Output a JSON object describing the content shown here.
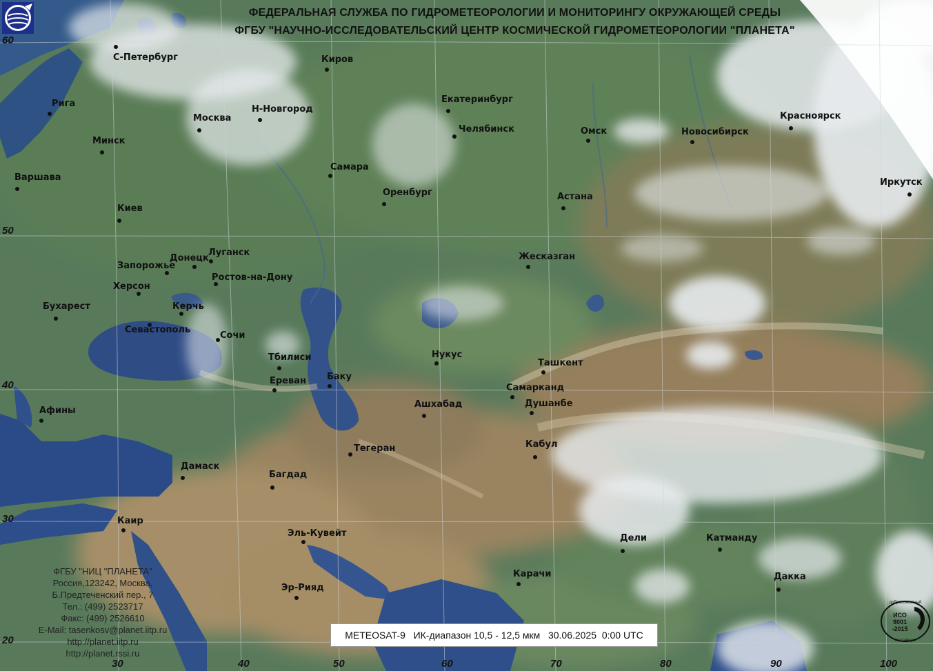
{
  "header": {
    "line1": "ФЕДЕРАЛЬНАЯ СЛУЖБА ПО ГИДРОМЕТЕОРОЛОГИИ И МОНИТОРИНГУ ОКРУЖАЮЩЕЙ СРЕДЫ",
    "line2": "ФГБУ \"НАУЧНО-ИССЛЕДОВАТЕЛЬСКИЙ ЦЕНТР КОСМИЧЕСКОЙ ГИДРОМЕТЕОРОЛОГИИ \"ПЛАНЕТА\""
  },
  "caption": {
    "text": "METEOSAT-9   ИК-диапазон 10,5 - 12,5 мкм   30.06.2025  0:00 UTC"
  },
  "contact": {
    "lines": [
      "ФГБУ \"НИЦ \"ПЛАНЕТА\"",
      "Россия,123242, Москва,",
      "Б.Предтеченский пер., 7",
      "Тел.:  (499) 2523717",
      "Факс: (499) 2526610",
      "E-Mail: tasenkosv@planet.iitp.ru",
      "http://planet.iitp.ru",
      "http://planet.rssi.ru"
    ]
  },
  "latitude_labels": [
    "60",
    "50",
    "40",
    "30",
    "20"
  ],
  "longitude_labels": [
    "30",
    "40",
    "50",
    "60",
    "70",
    "80",
    "90",
    "100"
  ],
  "cities": [
    "С-Петербург",
    "Киров",
    "Рига",
    "Екатеринбург",
    "Н-Новгород",
    "Москва",
    "Челябинск",
    "Омск",
    "Новосибирск",
    "Красноярск",
    "Минск",
    "Самара",
    "Варшава",
    "Оренбург",
    "Иркутск",
    "Астана",
    "Киев",
    "Луганск",
    "Донецк",
    "Жесказган",
    "Запорожье",
    "Ростов-на-Дону",
    "Херсон",
    "Керчь",
    "Бухарест",
    "Севастополь",
    "Сочи",
    "Нукус",
    "Тбилиси",
    "Ташкент",
    "Баку",
    "Ереван",
    "Самарканд",
    "Ашхабад",
    "Душанбе",
    "Афины",
    "Тегеран",
    "Кабул",
    "Дамаск",
    "Багдад",
    "Каир",
    "Эль-Кувейт",
    "Дели",
    "Катманду",
    "Карачи",
    "Дакка",
    "Эр-Рияд"
  ],
  "iso_badge": {
    "top_text": "добросовестный",
    "line1": "ИСО",
    "line2": "9001",
    "line3": "-2015",
    "bottom_text": "поставщик"
  },
  "colors": {
    "land": "#5d7f5c",
    "desert": "#a08763",
    "sea": "#2f4f86",
    "cloud": "#e4e8ec",
    "grid": "#c9cfd6"
  },
  "icons": {
    "logo": "roshydromet-globe-icon",
    "iso": "iso-certificate-badge-icon"
  }
}
